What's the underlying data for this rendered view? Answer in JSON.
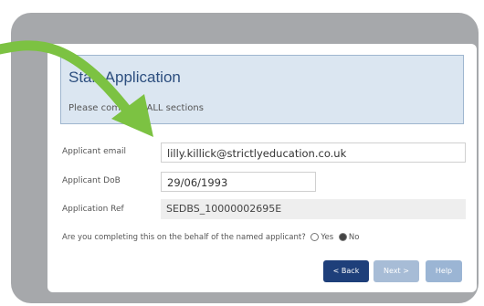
{
  "header": {
    "title": "Start Application",
    "subtitle": "Please complete ALL sections"
  },
  "form": {
    "email_label": "Applicant email",
    "email_value": "lilly.killick@strictlyeducation.co.uk",
    "dob_label": "Applicant DoB",
    "dob_value": "29/06/1993",
    "ref_label": "Application Ref",
    "ref_value": "SEDBS_10000002695E",
    "question": "Are you completing this on the behalf of the named applicant?",
    "radio_yes": "Yes",
    "radio_no": "No",
    "selected_option": "No"
  },
  "buttons": {
    "back": "< Back",
    "next": "Next >",
    "help": "Help"
  },
  "colors": {
    "arrow": "#7cc242",
    "frame": "#a6a8ab",
    "header_bg": "#dbe6f1",
    "primary_button": "#1e3f7a"
  }
}
